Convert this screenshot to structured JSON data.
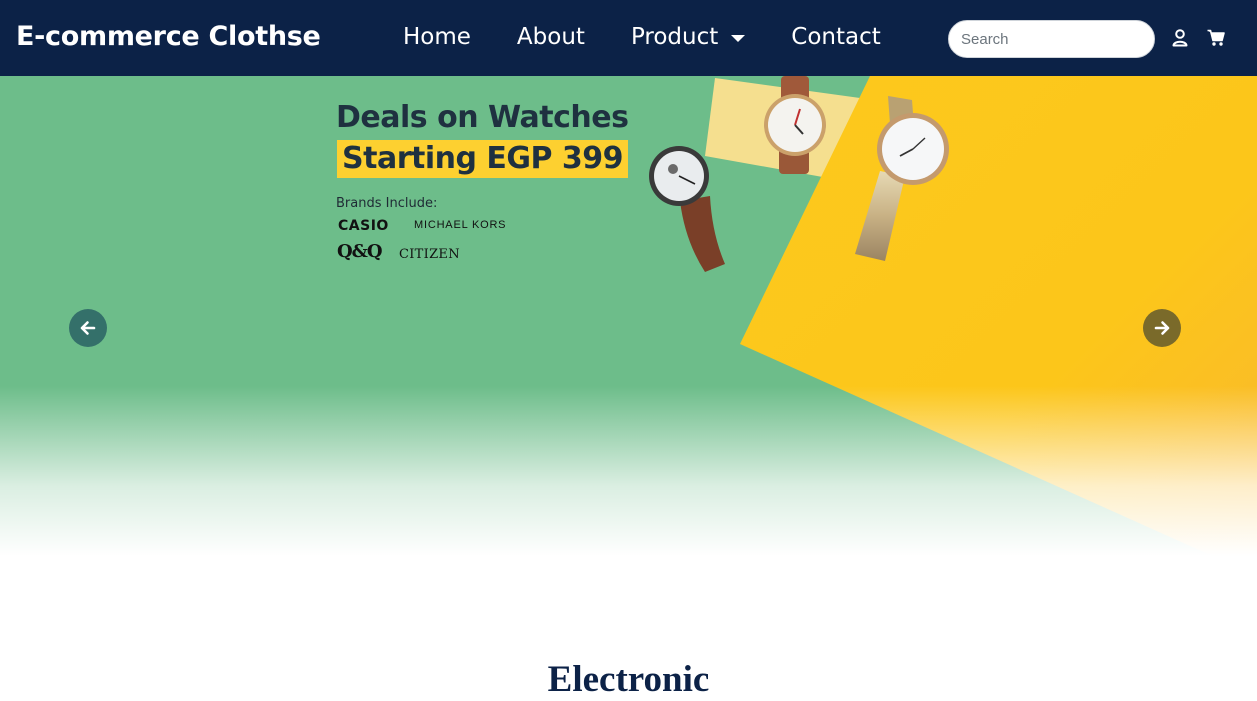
{
  "navbar": {
    "brand": "E-commerce Clothse",
    "links": [
      {
        "label": "Home"
      },
      {
        "label": "About"
      },
      {
        "label": "Product"
      },
      {
        "label": "Contact"
      }
    ],
    "search_placeholder": "Search",
    "icons": [
      "user-icon",
      "cart-icon"
    ],
    "background_color": "#0c2247"
  },
  "hero": {
    "title": "Deals on Watches",
    "price_banner": "Starting EGP 399",
    "brands_label": "Brands Include:",
    "brands": [
      "CASIO",
      "MICHAEL KORS",
      "Q&Q",
      "CITIZEN"
    ],
    "colors": {
      "green": "#6dbd8a",
      "yellow": "#fdc71e",
      "highlight": "#fdd030"
    }
  },
  "section": {
    "title": "Electronic"
  }
}
